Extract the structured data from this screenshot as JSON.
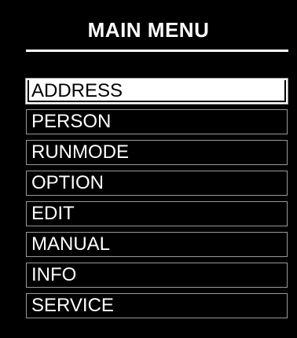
{
  "header": {
    "title": "MAIN MENU"
  },
  "menu": {
    "selected_index": 0,
    "items": [
      {
        "label": "ADDRESS"
      },
      {
        "label": "PERSON"
      },
      {
        "label": "RUNMODE"
      },
      {
        "label": "OPTION"
      },
      {
        "label": "EDIT"
      },
      {
        "label": "MANUAL"
      },
      {
        "label": "INFO"
      },
      {
        "label": "SERVICE"
      }
    ]
  },
  "colors": {
    "background": "#000000",
    "text": "#ffffff",
    "selected_background": "#ffffff",
    "selected_text": "#000000",
    "item_border": "#9a9a9a"
  }
}
